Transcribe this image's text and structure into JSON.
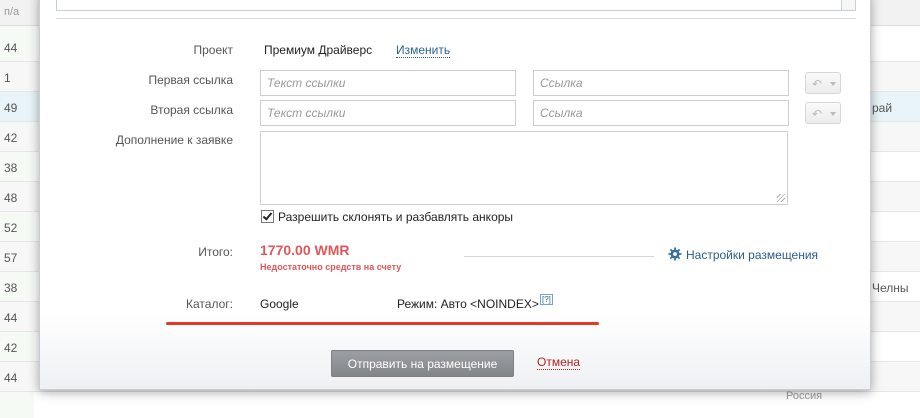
{
  "background": {
    "header_num": "п/а",
    "row_nums": [
      "44",
      "1",
      "49",
      "42",
      "38",
      "48",
      "52",
      "57",
      "38",
      "44",
      "42",
      "44"
    ],
    "right_texts": [
      "",
      "",
      "рай",
      "",
      "",
      "",
      "",
      "",
      "Челны",
      "",
      "",
      ""
    ],
    "bottom_row": [
      "Россия"
    ]
  },
  "form": {
    "project_label": "Проект",
    "project_value": "Премиум Драйверс",
    "project_change": "Изменить",
    "first_link_label": "Первая ссылка",
    "second_link_label": "Вторая ссылка",
    "link_text_placeholder": "Текст ссылки",
    "link_placeholder": "Ссылка",
    "addition_label": "Дополнение к заявке",
    "addition_value": "",
    "allow_anchor_label": "Разрешить склонять и разбавлять анкоры",
    "allow_anchor_checked": true,
    "total_label": "Итого:",
    "total_value": "1770.00 WMR",
    "insufficient_funds": "Недостаточно средств на счету",
    "settings_link": "Настройки размещения",
    "catalog_label": "Каталог:",
    "catalog_value": "Google",
    "mode_text": "Режим: Авто <NOINDEX>",
    "help_mark": "[?]",
    "send_button": "Отправить на размещение",
    "cancel_link": "Отмена"
  },
  "colors": {
    "accent_red": "#e05757",
    "underline_red": "#e8362c",
    "link_blue": "#2a6496"
  }
}
